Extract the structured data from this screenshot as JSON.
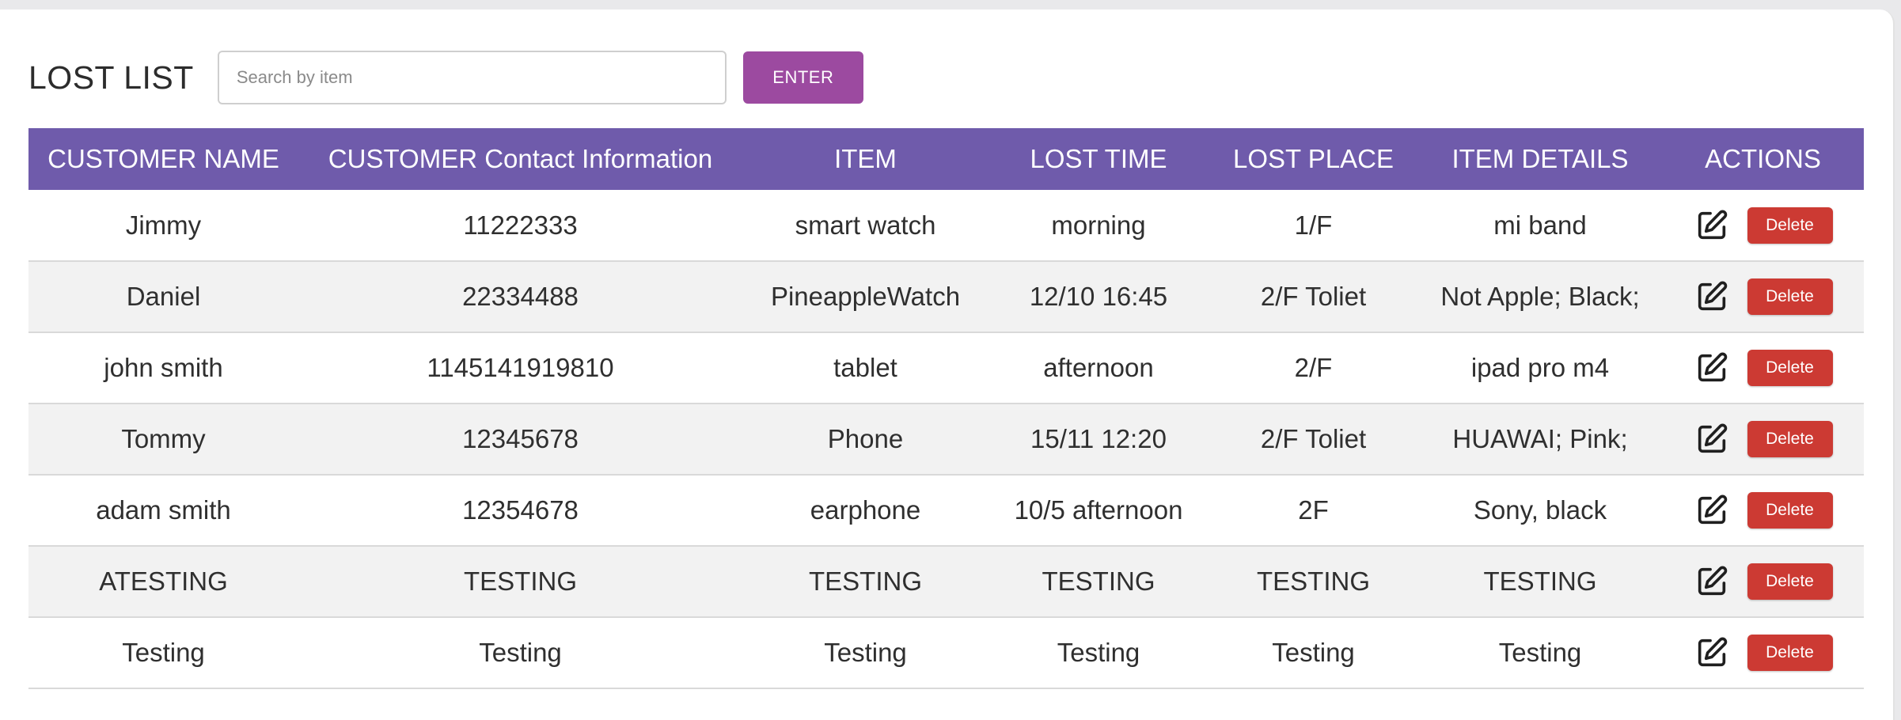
{
  "header": {
    "title": "LOST LIST",
    "search_placeholder": "Search by item",
    "search_value": "",
    "enter_label": "ENTER"
  },
  "table": {
    "columns": [
      "CUSTOMER NAME",
      "CUSTOMER Contact Information",
      "ITEM",
      "LOST TIME",
      "LOST PLACE",
      "ITEM DETAILS",
      "ACTIONS"
    ],
    "rows": [
      {
        "name": "Jimmy",
        "contact": "11222333",
        "item": "smart watch",
        "time": "morning",
        "place": "1/F",
        "details": "mi band",
        "delete_label": "Delete"
      },
      {
        "name": "Daniel",
        "contact": "22334488",
        "item": "PineappleWatch",
        "time": "12/10 16:45",
        "place": "2/F Toliet",
        "details": "Not Apple; Black;",
        "delete_label": "Delete"
      },
      {
        "name": "john smith",
        "contact": "1145141919810",
        "item": "tablet",
        "time": "afternoon",
        "place": "2/F",
        "details": "ipad pro m4",
        "delete_label": "Delete"
      },
      {
        "name": "Tommy",
        "contact": "12345678",
        "item": "Phone",
        "time": "15/11 12:20",
        "place": "2/F Toliet",
        "details": "HUAWAI; Pink;",
        "delete_label": "Delete"
      },
      {
        "name": "adam smith",
        "contact": "12354678",
        "item": "earphone",
        "time": "10/5 afternoon",
        "place": "2F",
        "details": "Sony, black",
        "delete_label": "Delete"
      },
      {
        "name": "ATESTING",
        "contact": "TESTING",
        "item": "TESTING",
        "time": "TESTING",
        "place": "TESTING",
        "details": "TESTING",
        "delete_label": "Delete"
      },
      {
        "name": "Testing",
        "contact": "Testing",
        "item": "Testing",
        "time": "Testing",
        "place": "Testing",
        "details": "Testing",
        "delete_label": "Delete"
      }
    ]
  },
  "icons": {
    "edit": "edit-icon"
  },
  "colors": {
    "header_bg": "#6f5bab",
    "enter_button": "#9c4aa0",
    "delete_button": "#cc3a33",
    "row_alt": "#f2f2f2"
  }
}
